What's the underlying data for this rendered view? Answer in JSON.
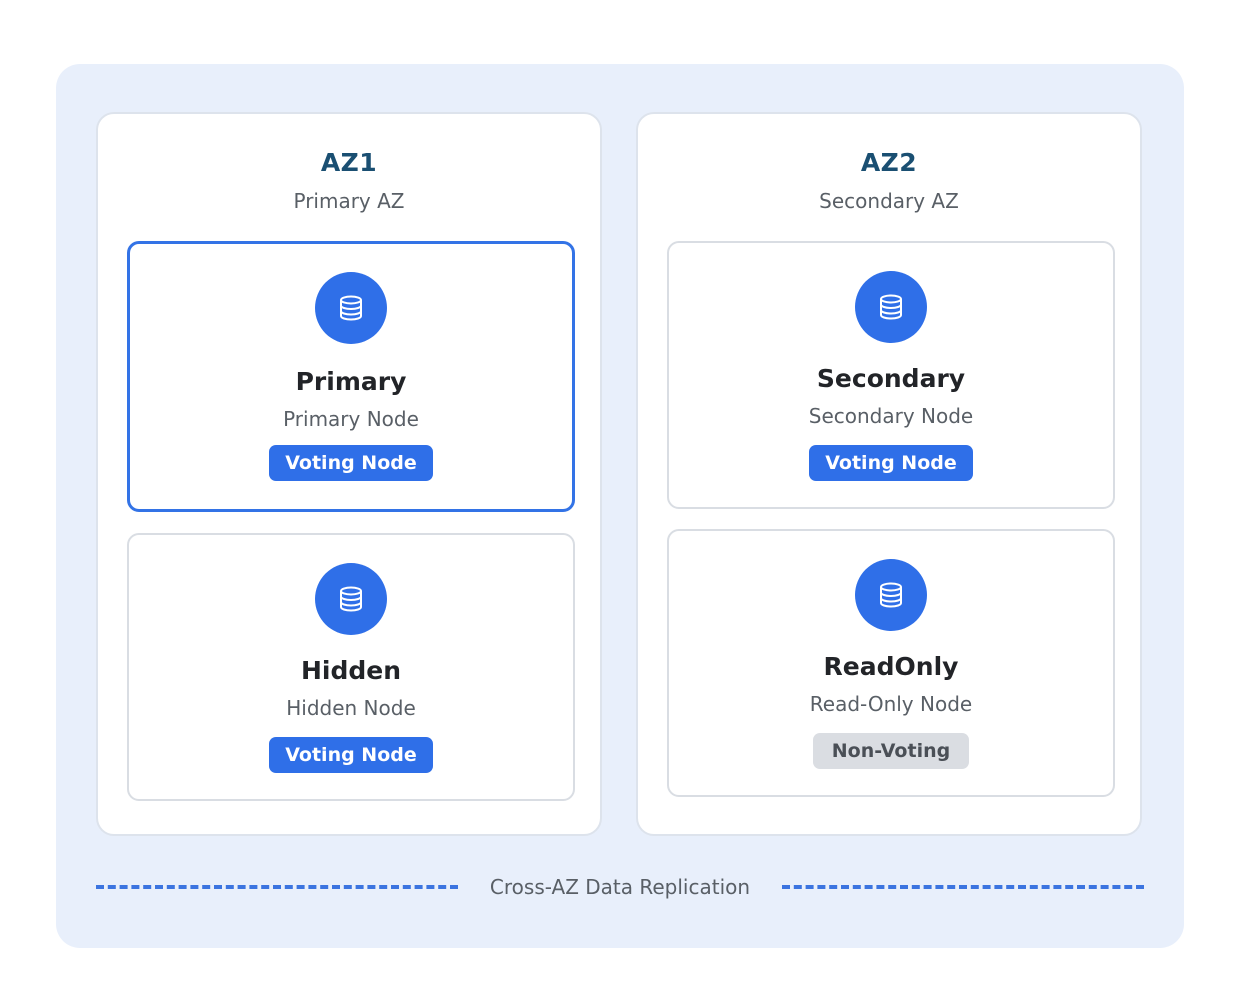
{
  "zones": [
    {
      "title": "AZ1",
      "subtitle": "Primary AZ",
      "nodes": [
        {
          "title": "Primary",
          "subtitle": "Primary Node",
          "badge": "Voting Node",
          "badge_type": "voting",
          "selected": true
        },
        {
          "title": "Hidden",
          "subtitle": "Hidden Node",
          "badge": "Voting Node",
          "badge_type": "voting",
          "selected": false
        }
      ]
    },
    {
      "title": "AZ2",
      "subtitle": "Secondary AZ",
      "nodes": [
        {
          "title": "Secondary",
          "subtitle": "Secondary Node",
          "badge": "Voting Node",
          "badge_type": "voting",
          "selected": false
        },
        {
          "title": "ReadOnly",
          "subtitle": "Read-Only Node",
          "badge": "Non-Voting",
          "badge_type": "non-voting",
          "selected": false
        }
      ]
    }
  ],
  "replication_label": "Cross-AZ Data Replication",
  "icons": {
    "node": "database-icon"
  },
  "colors": {
    "background_panel": "#e8effb",
    "accent": "#2f6fe8",
    "selected_border": "#3373e6",
    "zone_title": "#1a4f72",
    "non_voting_badge": "#dadde2"
  }
}
